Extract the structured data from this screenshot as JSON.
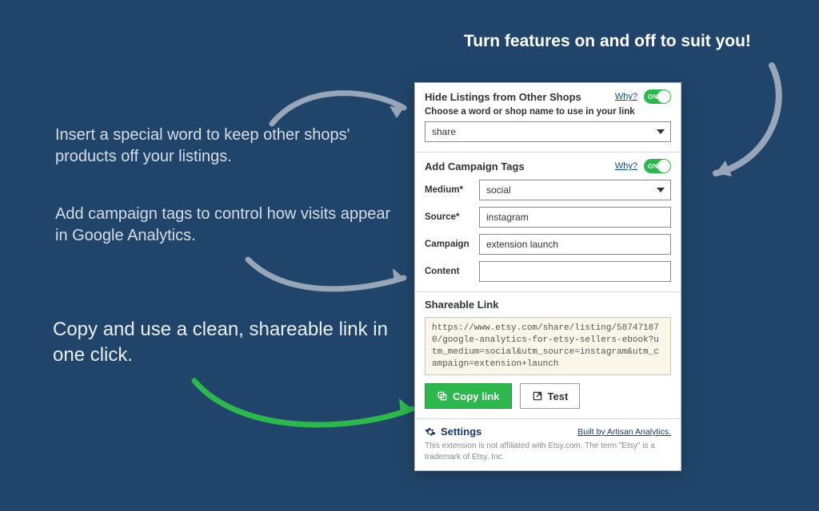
{
  "headline": "Turn features on and off to suit you!",
  "annotations": {
    "hide": "Insert a special word to keep other shops' products off your listings.",
    "tags": "Add campaign tags to control how visits appear in Google Analytics.",
    "copy": "Copy and use a clean, shareable link in one click."
  },
  "panel": {
    "hide": {
      "title": "Hide Listings from Other Shops",
      "why": "Why?",
      "on": true,
      "sublabel": "Choose a word or shop name to use in your link",
      "value": "share"
    },
    "tags": {
      "title": "Add Campaign Tags",
      "why": "Why?",
      "on": true,
      "medium_label": "Medium*",
      "medium_value": "social",
      "source_label": "Source*",
      "source_value": "instagram",
      "campaign_label": "Campaign",
      "campaign_value": "extension launch",
      "content_label": "Content",
      "content_value": ""
    },
    "share": {
      "title": "Shareable Link",
      "url": "https://www.etsy.com/share/listing/587471870/google-analytics-for-etsy-sellers-ebook?utm_medium=social&utm_source=instagram&utm_campaign=extension+launch",
      "copy_label": "Copy link",
      "test_label": "Test"
    },
    "footer": {
      "settings": "Settings",
      "built": "Built by Artisan Analytics.",
      "disclaimer": "This extension is not affiliated with Etsy.com. The term \"Etsy\" is a trademark of Etsy, Inc."
    }
  }
}
